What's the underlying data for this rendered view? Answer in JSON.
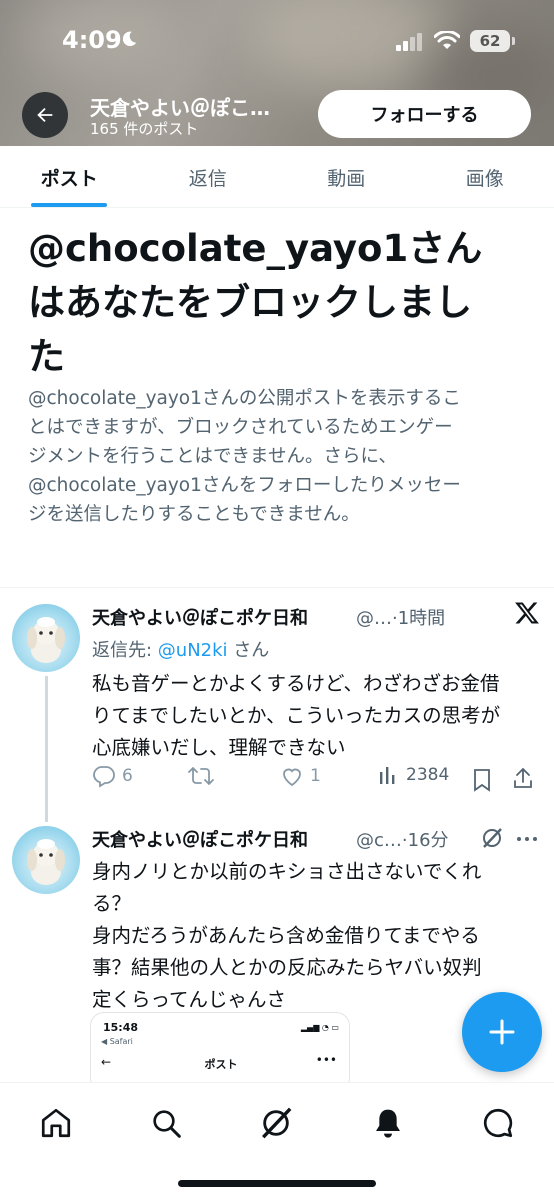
{
  "status_bar": {
    "time": "4:09",
    "battery": "62"
  },
  "header": {
    "profile_name": "天倉やよい＠ぽこ…",
    "post_count": "165 件のポスト",
    "follow_label": "フォローする"
  },
  "tabs": [
    {
      "label": "ポスト",
      "active": true
    },
    {
      "label": "返信",
      "active": false
    },
    {
      "label": "動画",
      "active": false
    },
    {
      "label": "画像",
      "active": false
    }
  ],
  "blocked": {
    "title_line1": "@chocolate_yayo1さん",
    "title_line2": "はあなたをブロックしまし",
    "title_line3": "た",
    "desc_line1": "@chocolate_yayo1さんの公開ポストを表示するこ",
    "desc_line2": "とはできますが、ブロックされているためエンゲー",
    "desc_line3": "ジメントを行うことはできません。さらに、",
    "desc_line4": "@chocolate_yayo1さんをフォローしたりメッセー",
    "desc_line5": "ジを送信したりすることもできません。"
  },
  "tweets": [
    {
      "name": "天倉やよい＠ぽこポケ日和",
      "handle_time": "@…·1時間",
      "reply_to_prefix": "返信先: ",
      "reply_to_handle": "@uN2ki",
      "reply_to_suffix": " さん",
      "line1": "私も音ゲーとかよくするけど、わざわざお金借",
      "line2": "りてまでしたいとか、こういったカスの思考が",
      "line3": "心底嫌いだし、理解できない",
      "replies": "6",
      "retweets": "",
      "likes": "1",
      "views": "2384"
    },
    {
      "name": "天倉やよい＠ぽこポケ日和",
      "handle_time": "@c…·16分",
      "line1": "身内ノリとか以前のキショさ出さないでくれ",
      "line2": "る？",
      "line3": "身内だろうがあんたら含め金借りてまでやる",
      "line4": "事？結果他の人とかの反応みたらヤバい奴判",
      "line5": "定くらってんじゃんさ",
      "embed": {
        "time": "15:48",
        "safari": "◀ Safari",
        "title": "ポスト"
      }
    }
  ],
  "colors": {
    "accent": "#1d9bf0",
    "text": "#0f1419",
    "secondary": "#536471"
  }
}
